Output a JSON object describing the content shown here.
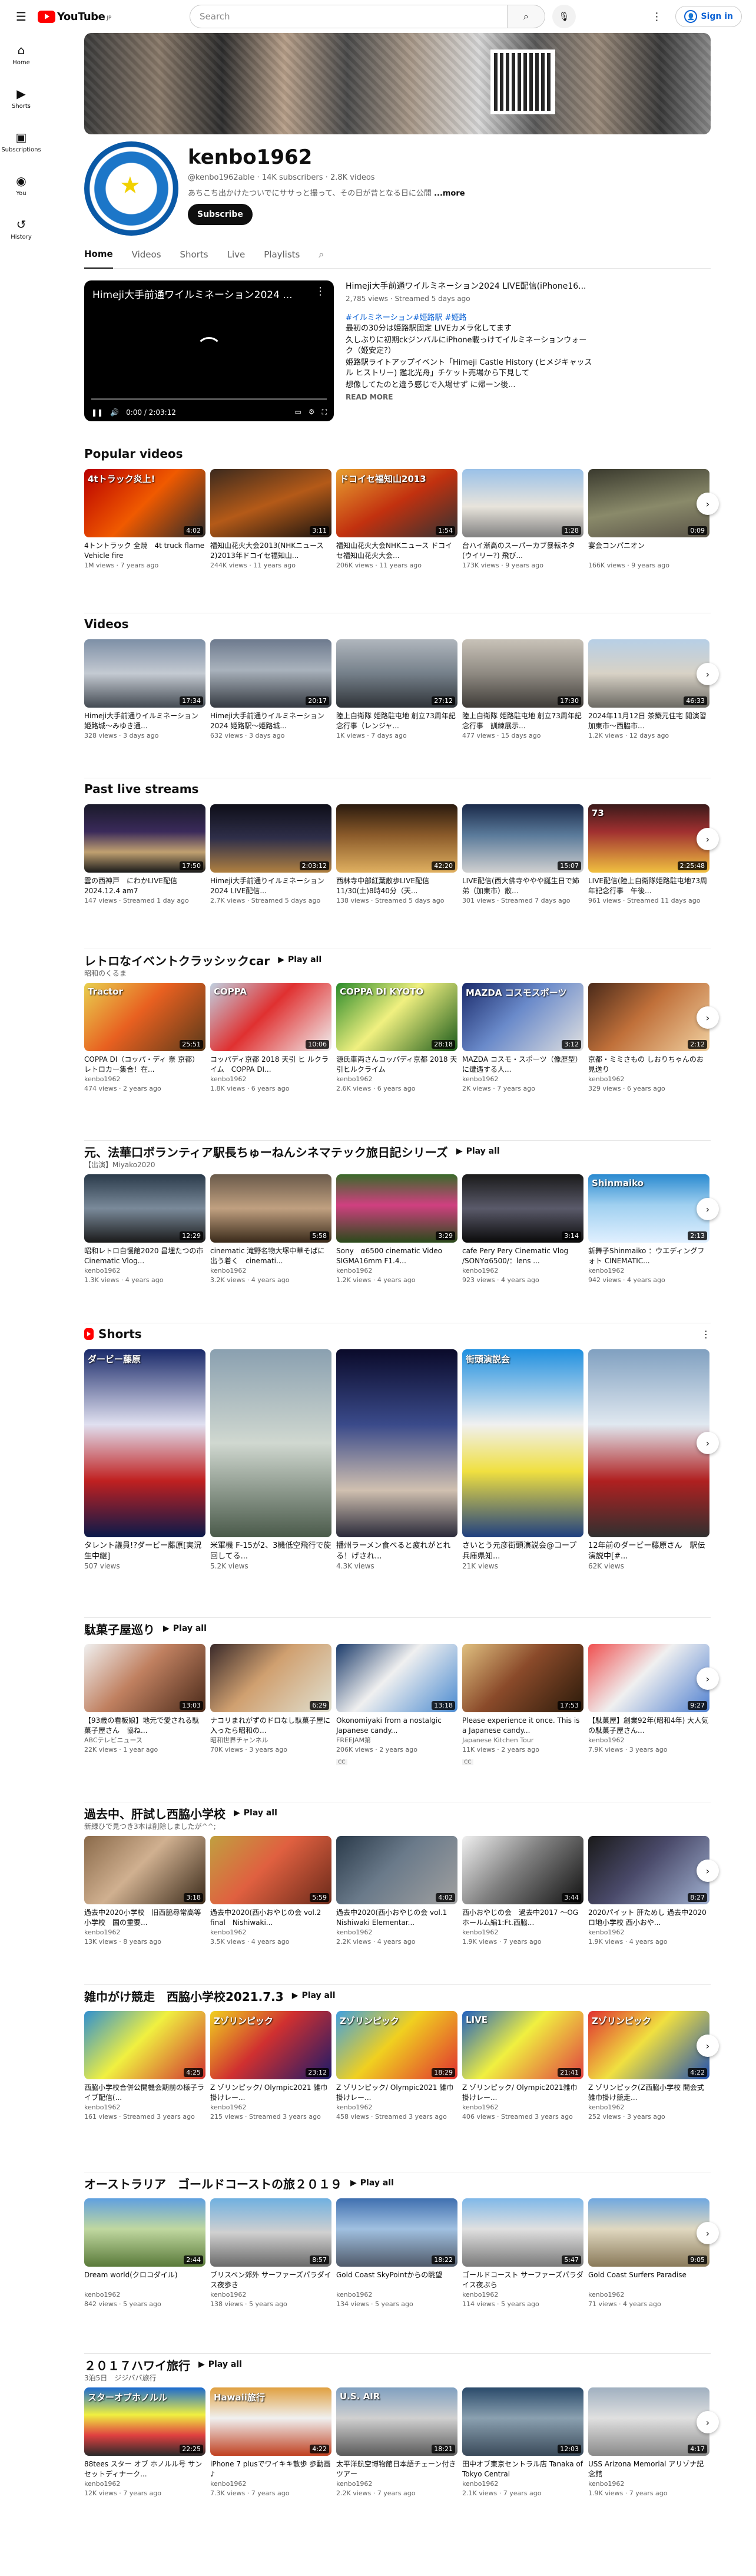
{
  "topbar": {
    "logo_text": "YouTube",
    "logo_country": "JP",
    "search_placeholder": "Search",
    "signin_label": "Sign in"
  },
  "sidebar": {
    "items": [
      {
        "label": "Home",
        "icon": "home-icon"
      },
      {
        "label": "Shorts",
        "icon": "shorts-icon"
      },
      {
        "label": "Subscriptions",
        "icon": "subscriptions-icon"
      },
      {
        "label": "You",
        "icon": "you-icon"
      },
      {
        "label": "History",
        "icon": "history-icon"
      }
    ]
  },
  "channel": {
    "name": "kenbo1962",
    "handle": "@kenbo1962able",
    "subscribers": "14K subscribers",
    "videos": "2.8K videos",
    "description": "あちこち出かけたついでにササっと撮って、その日が昔となる日に公開",
    "more": "...more",
    "subscribe_label": "Subscribe"
  },
  "tabs": [
    "Home",
    "Videos",
    "Shorts",
    "Live",
    "Playlists"
  ],
  "featured": {
    "player_title": "Himeji大手前通ワイルミネーション2024 ...",
    "time": "0:00 / 2:03:12",
    "title": "Himeji大手前通ワイルミネーション2024 LIVE配信(iPhone16...",
    "meta": "2,785 views · Streamed 5 days ago",
    "tags": "#イルミネーション#姫路駅 #姫路",
    "desc1": "最初の30分は姫路駅固定 LIVEカメラ化してます",
    "desc2": "久しぶりに初期ckジンバルにiPhone載っけてイルミネーションウォーク（姫安定?）",
    "desc3": "姫路駅ライトアップイベント「Himeji Castle History (ヒメジキャッスル ヒストリー) 鑑北光舟」チケット売場から下見して",
    "desc4": "想像してたのと違う感じで入場せず に帰ーン後...",
    "read_more": "READ MORE"
  },
  "sections": [
    {
      "title": "Popular videos",
      "sub": "",
      "play_all": "",
      "videos": [
        {
          "title": "4トントラック 全焼　4t truck flame Vehicle fire",
          "dur": "4:02",
          "meta": "1M views · 7 years ago",
          "chan": "",
          "overlay": "4tトラック炎上!"
        },
        {
          "title": "福知山花火大会2013(NHKニュース2)2013年ドコイセ福知山...",
          "dur": "3:11",
          "meta": "244K views · 11 years ago",
          "chan": "",
          "overlay": ""
        },
        {
          "title": "福知山花火大会NHKニュース ドコイセ福知山花火大会...",
          "dur": "1:54",
          "meta": "206K views · 11 years ago",
          "chan": "",
          "overlay": "ドコイセ福知山2013"
        },
        {
          "title": "台ハイ漸高のスーパーカブ暴転ネタ(ウイリー?) 飛び...",
          "dur": "1:28",
          "meta": "173K views · 9 years ago",
          "chan": "",
          "overlay": ""
        },
        {
          "title": "宴会コンパニオン",
          "dur": "0:09",
          "meta": "166K views · 9 years ago",
          "chan": "",
          "overlay": ""
        }
      ]
    },
    {
      "title": "Videos",
      "sub": "",
      "play_all": "",
      "videos": [
        {
          "title": "Himeji大手前通りイルミネーション　姫路城〜みゆき通...",
          "dur": "17:34",
          "meta": "328 views · 3 days ago",
          "chan": "",
          "overlay": ""
        },
        {
          "title": "Himeji大手前通りイルミネーション2024 姫路駅〜姫路城...",
          "dur": "20:17",
          "meta": "632 views · 3 days ago",
          "chan": "",
          "overlay": ""
        },
        {
          "title": "陸上自衛隊 姫路駐屯地 創立73周年記念行事（レンジャ...",
          "dur": "27:12",
          "meta": "1K views · 7 days ago",
          "chan": "",
          "overlay": ""
        },
        {
          "title": "陸上自衛隊 姫路駐屯地 創立73周年記念行事　訓練展示...",
          "dur": "17:30",
          "meta": "477 views · 15 days ago",
          "chan": "",
          "overlay": ""
        },
        {
          "title": "2024年11月12日 茶築元住宅 閲演習　加東市〜西脇市...",
          "dur": "46:33",
          "meta": "1.2K views · 12 days ago",
          "chan": "",
          "overlay": ""
        }
      ]
    },
    {
      "title": "Past live streams",
      "sub": "",
      "play_all": "",
      "videos": [
        {
          "title": "雲の西神戸　にわかLIVE配信 2024.12.4 am7",
          "dur": "17:50",
          "meta": "147 views · Streamed 1 day ago",
          "chan": "",
          "overlay": ""
        },
        {
          "title": "Himeji大手前通りイルミネーション2024 LIVE配信...",
          "dur": "2:03:12",
          "meta": "2.7K views · Streamed 5 days ago",
          "chan": "",
          "overlay": ""
        },
        {
          "title": "西林寺中部紅葉散歩LIVE配信11/30(土)8時40分（天...",
          "dur": "42:20",
          "meta": "138 views · Streamed 5 days ago",
          "chan": "",
          "overlay": ""
        },
        {
          "title": "LIVE配信(西大佛寺ややや誕生日で姉弟（加東市）散...",
          "dur": "15:07",
          "meta": "301 views · Streamed 7 days ago",
          "chan": "",
          "overlay": ""
        },
        {
          "title": "LIVE配信(陸上自衛隊姫路駐屯地73周年記念行事　午後...",
          "dur": "2:25:48",
          "meta": "961 views · Streamed 11 days ago",
          "chan": "",
          "overlay": "73"
        }
      ]
    },
    {
      "title": "レトロなイベントクラッシックcar",
      "sub": "昭和のくるま",
      "play_all": "Play all",
      "videos": [
        {
          "title": "COPPA DI（コッパ・ディ 奈 京都）レトロカー集合！在...",
          "dur": "25:51",
          "meta": "474 views · 2 years ago",
          "chan": "kenbo1962",
          "overlay": "Tractor"
        },
        {
          "title": "コッパディ京都 2018 天引 ヒ ルクライム　COPPA DI...",
          "dur": "10:06",
          "meta": "1.8K views · 6 years ago",
          "chan": "kenbo1962",
          "overlay": "COPPA"
        },
        {
          "title": "源氏車両さんコッパディ京都 2018 天引ヒルクライム",
          "dur": "28:18",
          "meta": "2.6K views · 6 years ago",
          "chan": "kenbo1962",
          "overlay": "COPPA DI KYOTO"
        },
        {
          "title": "MAZDA コスモ・スポーツ（像歴型）に遭遇する人...",
          "dur": "3:12",
          "meta": "2K views · 7 years ago",
          "chan": "kenbo1962",
          "overlay": "MAZDA コスモスポーツ"
        },
        {
          "title": "京都・ミミさもの しおりちゃんのお見送り",
          "dur": "2:12",
          "meta": "329 views · 6 years ago",
          "chan": "kenbo1962",
          "overlay": ""
        }
      ]
    },
    {
      "title": "元、法華口ボランティア駅長ちゅーねんシネマテック旅日記シリーズ",
      "sub": "【出演】Miyako2020",
      "play_all": "Play all",
      "videos": [
        {
          "title": "昭和レトロ自慢館2020 昌埋たつの市Cinematic Vlog...",
          "dur": "12:29",
          "meta": "1.3K views · 4 years ago",
          "chan": "kenbo1962",
          "overlay": ""
        },
        {
          "title": "cinematic 滝野名物大塚中華そばに出う着く　cinemati...",
          "dur": "5:58",
          "meta": "3.2K views · 4 years ago",
          "chan": "kenbo1962",
          "overlay": ""
        },
        {
          "title": "Sony　α6500 cinematic Video　SIGMA16mm F1.4...",
          "dur": "3:29",
          "meta": "1.2K views · 4 years ago",
          "chan": "kenbo1962",
          "overlay": ""
        },
        {
          "title": "cafe Pery Pery Cinematic Vlog /SONYα6500/：lens ...",
          "dur": "3:14",
          "meta": "923 views · 4 years ago",
          "chan": "kenbo1962",
          "overlay": ""
        },
        {
          "title": "新舞子Shinmaiko ：ウエディングフォト CINEMATIC...",
          "dur": "2:13",
          "meta": "942 views · 4 years ago",
          "chan": "kenbo1962",
          "overlay": "Shinmaiko"
        }
      ]
    }
  ],
  "shorts": {
    "title": "Shorts",
    "items": [
      {
        "title": "タレント議員!?ダービー藤原[実況生中継]",
        "views": "507 views",
        "overlay": "ダービー藤原"
      },
      {
        "title": "米軍機 F-15が2、3機低空飛行で旋回してる...",
        "views": "5.2K views",
        "overlay": ""
      },
      {
        "title": "播州ラーメン食べると疲れがとれる！げされ...",
        "views": "4.3K views",
        "overlay": ""
      },
      {
        "title": "さいとう元彦街頭演説会@コープ　兵庫県知...",
        "views": "21K views",
        "overlay": "街頭演説会"
      },
      {
        "title": "12年前のダービー藤原さん　駅伝演説中[#...",
        "views": "62K views",
        "overlay": ""
      }
    ]
  },
  "sections2": [
    {
      "title": "駄菓子屋巡り",
      "sub": "",
      "play_all": "Play all",
      "videos": [
        {
          "title": "【93歳の看板娘】地元で愛される駄菓子屋さん　協ね...",
          "dur": "13:03",
          "meta": "ABCテレビニュース",
          "chan": "22K views · 1 year ago",
          "overlay": ""
        },
        {
          "title": "ナコリまれがずのドロなし駄菓子屋に入ったら昭和の...",
          "dur": "6:29",
          "meta": "昭和世界チャンネル",
          "chan": "70K views · 3 years ago",
          "overlay": ""
        },
        {
          "title": "Okonomiyaki from a nostalgic Japanese candy...",
          "dur": "13:18",
          "meta": "FREEJAM第",
          "chan": "206K views · 2 years ago",
          "overlay": "",
          "cc": "CC"
        },
        {
          "title": "Please experience it once. This is a Japanese candy...",
          "dur": "17:53",
          "meta": "Japanese Kitchen Tour",
          "chan": "11K views · 2 years ago",
          "overlay": "",
          "cc": "CC"
        },
        {
          "title": "【駄菓屋】創業92年(昭和4年) 大人気の駄菓子屋さん...",
          "dur": "9:27",
          "meta": "kenbo1962",
          "chan": "7.9K views · 3 years ago",
          "overlay": ""
        }
      ]
    },
    {
      "title": "過去中、肝試し西脇小学校",
      "sub": "新緑ひで見つき3本は削除しましたが^^;",
      "play_all": "Play all",
      "videos": [
        {
          "title": "過去中2020小学校　旧西脇尋常高等小学校　国の重要...",
          "dur": "3:18",
          "meta": "kenbo1962",
          "chan": "13K views · 8 years ago",
          "overlay": ""
        },
        {
          "title": "過去中2020(西小おやじの会 vol.2 final　Nishiwaki...",
          "dur": "5:59",
          "meta": "kenbo1962",
          "chan": "3.5K views · 4 years ago",
          "overlay": ""
        },
        {
          "title": "過去中2020(西小おやじの会 vol.1　Nishiwaki Elementar...",
          "dur": "4:02",
          "meta": "kenbo1962",
          "chan": "2.2K views · 4 years ago",
          "overlay": ""
        },
        {
          "title": "西小おやじの会　過去中2017 〜OGホールム編1:Ft.西脇...",
          "dur": "3:44",
          "meta": "kenbo1962",
          "chan": "1.9K views · 7 years ago",
          "overlay": ""
        },
        {
          "title": "2020パイット 肝ためし 過去中2020ロ地小学校 西小おや...",
          "dur": "8:27",
          "meta": "kenbo1962",
          "chan": "1.9K views · 4 years ago",
          "overlay": ""
        }
      ]
    },
    {
      "title": "雑巾がけ競走　西脇小学校2021.7.3",
      "sub": "",
      "play_all": "Play all",
      "videos": [
        {
          "title": "西脇小学校合併公開機会期前の様子ライブ配信(...",
          "dur": "4:25",
          "meta": "kenbo1962",
          "chan": "161 views · Streamed 3 years ago",
          "overlay": ""
        },
        {
          "title": "Z ゾリンピック/ Olympic2021 雑巾掛けレー...",
          "dur": "23:12",
          "meta": "kenbo1962",
          "chan": "215 views · Streamed 3 years ago",
          "overlay": "Zゾリンピック"
        },
        {
          "title": "Z ゾリンピック/ Olympic2021 雑巾掛けレー...",
          "dur": "18:29",
          "meta": "kenbo1962",
          "chan": "458 views · Streamed 3 years ago",
          "overlay": "Zゾリンピック"
        },
        {
          "title": "Z ゾリンピック/ Olympic2021雑巾掛けレー...",
          "dur": "21:41",
          "meta": "kenbo1962",
          "chan": "406 views · Streamed 3 years ago",
          "overlay": "LIVE"
        },
        {
          "title": "Z ゾリンピック(Z西脇小学校 開会式雑巾掛け競走...",
          "dur": "4:22",
          "meta": "kenbo1962",
          "chan": "252 views · 3 years ago",
          "overlay": "Zゾリンピック"
        }
      ]
    },
    {
      "title": "オーストラリア　ゴールドコーストの旅２０１９",
      "sub": "",
      "play_all": "Play all",
      "videos": [
        {
          "title": "Dream world(クロコダイル)",
          "dur": "2:44",
          "meta": "kenbo1962",
          "chan": "842 views · 5 years ago",
          "overlay": ""
        },
        {
          "title": "ブリスベン郊外 サーファーズパラダイス夜歩き",
          "dur": "8:57",
          "meta": "kenbo1962",
          "chan": "138 views · 5 years ago",
          "overlay": ""
        },
        {
          "title": "Gold Coast SkyPointからの眺望",
          "dur": "18:22",
          "meta": "kenbo1962",
          "chan": "134 views · 5 years ago",
          "overlay": ""
        },
        {
          "title": "ゴールドコースト サーファーズパラダイス夜ぶら",
          "dur": "5:47",
          "meta": "kenbo1962",
          "chan": "114 views · 5 years ago",
          "overlay": ""
        },
        {
          "title": "Gold Coast Surfers Paradise",
          "dur": "9:05",
          "meta": "kenbo1962",
          "chan": "71 views · 4 years ago",
          "overlay": ""
        }
      ]
    },
    {
      "title": "２０１７ハワイ旅行",
      "sub": "3泊5日　ジジババ旅行",
      "play_all": "Play all",
      "videos": [
        {
          "title": "88tees スター オブ ホノルル号 サンセットディナーク...",
          "dur": "22:25",
          "meta": "kenbo1962",
          "chan": "12K views · 7 years ago",
          "overlay": "スターオブホノルル"
        },
        {
          "title": "iPhone 7 plusでワイキキ散歩 歩動画♪",
          "dur": "4:22",
          "meta": "kenbo1962",
          "chan": "7.3K views · 7 years ago",
          "overlay": "Hawaii旅行"
        },
        {
          "title": "太平洋航空博物館日本語チェーン付きツアー",
          "dur": "18:21",
          "meta": "kenbo1962",
          "chan": "2.2K views · 7 years ago",
          "overlay": "U.S. AIR"
        },
        {
          "title": "田中オブ東京セントラル店 Tanaka of Tokyo Central",
          "dur": "12:03",
          "meta": "kenbo1962",
          "chan": "2.1K views · 7 years ago",
          "overlay": ""
        },
        {
          "title": "USS Arizona Memorial アリゾナ記念館",
          "dur": "4:17",
          "meta": "kenbo1962",
          "chan": "1.9K views · 7 years ago",
          "overlay": ""
        }
      ]
    }
  ],
  "colors": {
    "accent": "#ff0000",
    "link": "#065fd4",
    "text": "#0f0f0f",
    "meta": "#606060"
  }
}
